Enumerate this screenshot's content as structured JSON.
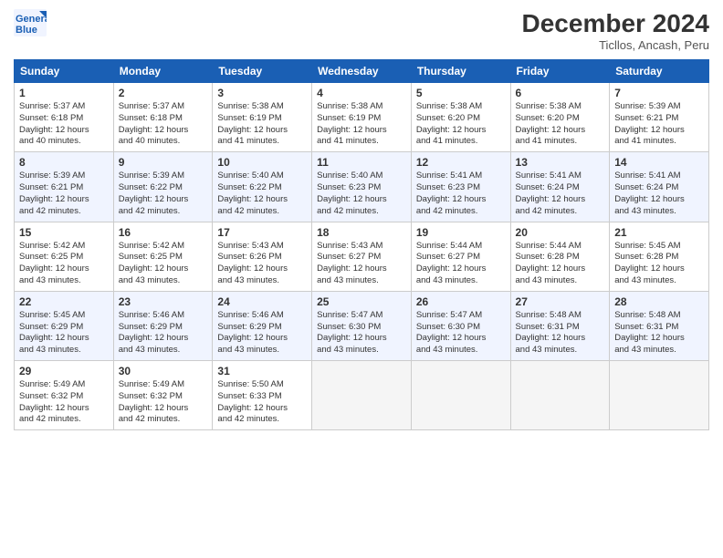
{
  "header": {
    "logo_line1": "General",
    "logo_line2": "Blue",
    "month_title": "December 2024",
    "location": "Ticllos, Ancash, Peru"
  },
  "weekdays": [
    "Sunday",
    "Monday",
    "Tuesday",
    "Wednesday",
    "Thursday",
    "Friday",
    "Saturday"
  ],
  "weeks": [
    [
      {
        "day": "1",
        "sunrise": "5:37 AM",
        "sunset": "6:18 PM",
        "daylight": "12 hours and 40 minutes."
      },
      {
        "day": "2",
        "sunrise": "5:37 AM",
        "sunset": "6:18 PM",
        "daylight": "12 hours and 40 minutes."
      },
      {
        "day": "3",
        "sunrise": "5:38 AM",
        "sunset": "6:19 PM",
        "daylight": "12 hours and 41 minutes."
      },
      {
        "day": "4",
        "sunrise": "5:38 AM",
        "sunset": "6:19 PM",
        "daylight": "12 hours and 41 minutes."
      },
      {
        "day": "5",
        "sunrise": "5:38 AM",
        "sunset": "6:20 PM",
        "daylight": "12 hours and 41 minutes."
      },
      {
        "day": "6",
        "sunrise": "5:38 AM",
        "sunset": "6:20 PM",
        "daylight": "12 hours and 41 minutes."
      },
      {
        "day": "7",
        "sunrise": "5:39 AM",
        "sunset": "6:21 PM",
        "daylight": "12 hours and 41 minutes."
      }
    ],
    [
      {
        "day": "8",
        "sunrise": "5:39 AM",
        "sunset": "6:21 PM",
        "daylight": "12 hours and 42 minutes."
      },
      {
        "day": "9",
        "sunrise": "5:39 AM",
        "sunset": "6:22 PM",
        "daylight": "12 hours and 42 minutes."
      },
      {
        "day": "10",
        "sunrise": "5:40 AM",
        "sunset": "6:22 PM",
        "daylight": "12 hours and 42 minutes."
      },
      {
        "day": "11",
        "sunrise": "5:40 AM",
        "sunset": "6:23 PM",
        "daylight": "12 hours and 42 minutes."
      },
      {
        "day": "12",
        "sunrise": "5:41 AM",
        "sunset": "6:23 PM",
        "daylight": "12 hours and 42 minutes."
      },
      {
        "day": "13",
        "sunrise": "5:41 AM",
        "sunset": "6:24 PM",
        "daylight": "12 hours and 42 minutes."
      },
      {
        "day": "14",
        "sunrise": "5:41 AM",
        "sunset": "6:24 PM",
        "daylight": "12 hours and 43 minutes."
      }
    ],
    [
      {
        "day": "15",
        "sunrise": "5:42 AM",
        "sunset": "6:25 PM",
        "daylight": "12 hours and 43 minutes."
      },
      {
        "day": "16",
        "sunrise": "5:42 AM",
        "sunset": "6:25 PM",
        "daylight": "12 hours and 43 minutes."
      },
      {
        "day": "17",
        "sunrise": "5:43 AM",
        "sunset": "6:26 PM",
        "daylight": "12 hours and 43 minutes."
      },
      {
        "day": "18",
        "sunrise": "5:43 AM",
        "sunset": "6:27 PM",
        "daylight": "12 hours and 43 minutes."
      },
      {
        "day": "19",
        "sunrise": "5:44 AM",
        "sunset": "6:27 PM",
        "daylight": "12 hours and 43 minutes."
      },
      {
        "day": "20",
        "sunrise": "5:44 AM",
        "sunset": "6:28 PM",
        "daylight": "12 hours and 43 minutes."
      },
      {
        "day": "21",
        "sunrise": "5:45 AM",
        "sunset": "6:28 PM",
        "daylight": "12 hours and 43 minutes."
      }
    ],
    [
      {
        "day": "22",
        "sunrise": "5:45 AM",
        "sunset": "6:29 PM",
        "daylight": "12 hours and 43 minutes."
      },
      {
        "day": "23",
        "sunrise": "5:46 AM",
        "sunset": "6:29 PM",
        "daylight": "12 hours and 43 minutes."
      },
      {
        "day": "24",
        "sunrise": "5:46 AM",
        "sunset": "6:29 PM",
        "daylight": "12 hours and 43 minutes."
      },
      {
        "day": "25",
        "sunrise": "5:47 AM",
        "sunset": "6:30 PM",
        "daylight": "12 hours and 43 minutes."
      },
      {
        "day": "26",
        "sunrise": "5:47 AM",
        "sunset": "6:30 PM",
        "daylight": "12 hours and 43 minutes."
      },
      {
        "day": "27",
        "sunrise": "5:48 AM",
        "sunset": "6:31 PM",
        "daylight": "12 hours and 43 minutes."
      },
      {
        "day": "28",
        "sunrise": "5:48 AM",
        "sunset": "6:31 PM",
        "daylight": "12 hours and 43 minutes."
      }
    ],
    [
      {
        "day": "29",
        "sunrise": "5:49 AM",
        "sunset": "6:32 PM",
        "daylight": "12 hours and 42 minutes."
      },
      {
        "day": "30",
        "sunrise": "5:49 AM",
        "sunset": "6:32 PM",
        "daylight": "12 hours and 42 minutes."
      },
      {
        "day": "31",
        "sunrise": "5:50 AM",
        "sunset": "6:33 PM",
        "daylight": "12 hours and 42 minutes."
      },
      null,
      null,
      null,
      null
    ]
  ],
  "labels": {
    "sunrise": "Sunrise:",
    "sunset": "Sunset:",
    "daylight": "Daylight:"
  }
}
